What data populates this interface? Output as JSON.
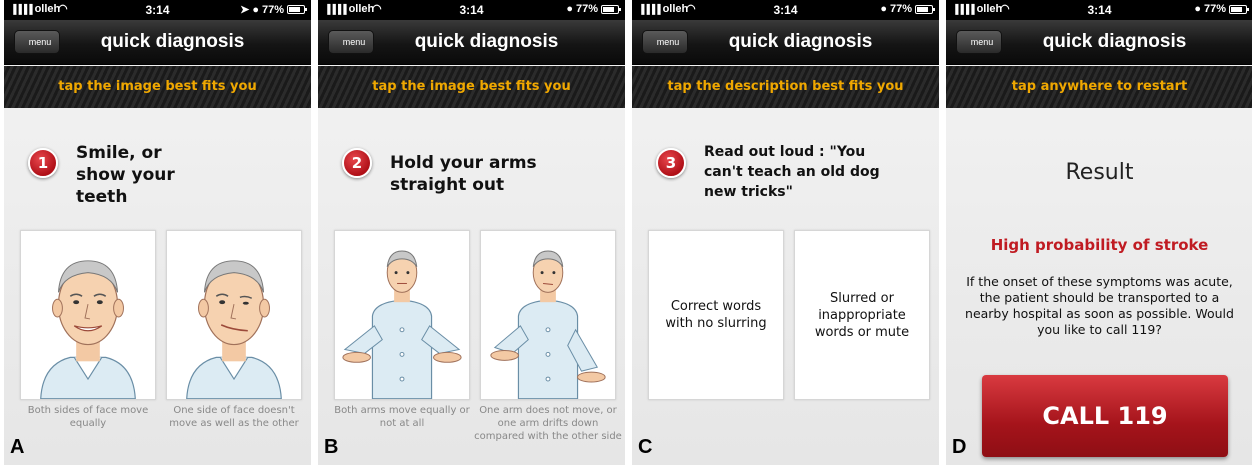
{
  "status_bar": {
    "carrier": "olleh",
    "signal": "▐▐▐▐",
    "wifi": "◠",
    "time": "3:14",
    "location_glyph": "➤",
    "alarm_glyph": "●",
    "battery": "77%"
  },
  "nav": {
    "menu_label": "menu",
    "title": "quick diagnosis"
  },
  "panels": [
    {
      "letter": "A",
      "hint": "tap the image best fits you",
      "step_number": "1",
      "step_text": "Smile, or show your teeth",
      "left_caption": "Both sides of face move equally",
      "right_caption": "One side of face doesn't move as well as the other"
    },
    {
      "letter": "B",
      "hint": "tap the image best fits you",
      "step_number": "2",
      "step_text": "Hold your arms straight out",
      "left_caption": "Both arms move equally or not at all",
      "right_caption": "One arm does not move, or one arm drifts down compared with the other side"
    },
    {
      "letter": "C",
      "hint": "tap the description best fits you",
      "step_number": "3",
      "step_text": "Read out loud : \"You can't teach an old dog new tricks\"",
      "left_card_text": "Correct words with no slurring",
      "right_card_text": "Slurred or inappropriate words or mute"
    },
    {
      "letter": "D",
      "hint": "tap anywhere to restart",
      "result_title": "Result",
      "result_main": "High probability of stroke",
      "result_desc": "If the onset of these symptoms was acute, the patient should be transported to a nearby hospital as soon as possible. Would you like to call 119?",
      "call_button": "CALL 119"
    }
  ],
  "colors": {
    "hint_text": "#f0a800",
    "accent_red": "#c01b22",
    "nav_bg": "#151515"
  }
}
